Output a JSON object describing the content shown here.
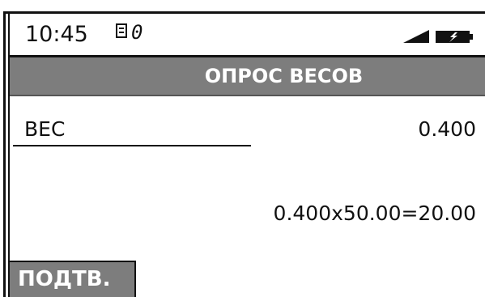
{
  "status_bar": {
    "time": "10:45",
    "zero_indicator": "0",
    "icons": [
      "document-icon",
      "zero-slash-icon",
      "signal-icon",
      "battery-icon"
    ]
  },
  "header": {
    "title": "ОПРОС ВЕСОВ"
  },
  "weight": {
    "label": "ВЕС",
    "value": "0.400"
  },
  "calculation": {
    "text": "0.400x50.00=20.00"
  },
  "softkeys": {
    "confirm_label": "ПОДТВ."
  },
  "colors": {
    "bar_gray": "#7d7d7d",
    "ink": "#111111",
    "background": "#ffffff"
  }
}
